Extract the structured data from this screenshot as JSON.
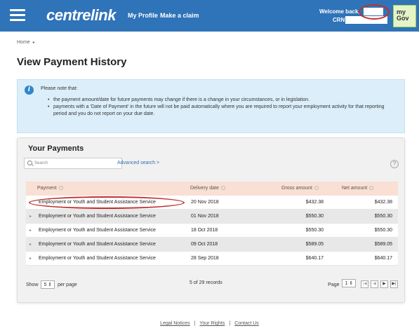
{
  "header": {
    "logo": "centrelink",
    "nav": {
      "profile": "My Profile",
      "claim": "Make a claim"
    },
    "welcome": "Welcome back,",
    "crn_label": "CRN",
    "mygov": {
      "line1": "my",
      "line2": "Gov"
    },
    "bg_color": "#2f73b8"
  },
  "breadcrumb": {
    "home": "Home",
    "arrow": "▸"
  },
  "page_title": "View Payment History",
  "notice": {
    "title": "Please note that:",
    "items": [
      "the payment amount/date for future payments may change if there is a change in your circumstances, or in legislation.",
      "payments with a 'Date of Payment' in the future will not be paid automatically where you are required to report your employment activity for that reporting period and you do not report on your due date."
    ]
  },
  "payments": {
    "title": "Your Payments",
    "search_placeholder": "Search",
    "advanced_search": "Advanced search >",
    "columns": [
      "Payment",
      "Delivery date",
      "Gross amount",
      "Net amount"
    ],
    "rows": [
      {
        "payment": "Employment or Youth and Student Assistance Service",
        "date": "20 Nov 2018",
        "gross": "$432.38",
        "net": "$432.38"
      },
      {
        "payment": "Employment or Youth and Student Assistance Service",
        "date": "01 Nov 2018",
        "gross": "$550.30",
        "net": "$550.30"
      },
      {
        "payment": "Employment or Youth and Student Assistance Service",
        "date": "18 Oct 2018",
        "gross": "$550.30",
        "net": "$550.30"
      },
      {
        "payment": "Employment or Youth and Student Assistance Service",
        "date": "09 Oct 2018",
        "gross": "$589.05",
        "net": "$589.05"
      },
      {
        "payment": "Employment or Youth and Student Assistance Service",
        "date": "28 Sep 2018",
        "gross": "$640.17",
        "net": "$640.17"
      }
    ],
    "show_label": "Show",
    "per_page_value": "5 ⇕",
    "per_page_label": "per page",
    "records": "5 of 29 records",
    "page_label": "Page",
    "page_value": "1 ⇕",
    "pager": {
      "first": "|◀",
      "prev": "◀",
      "next": "▶",
      "last": "▶|"
    },
    "header_bg": "#f9dfd4"
  },
  "footer": {
    "legal": "Legal Notices",
    "rights": "Your Rights",
    "contact": "Contact Us",
    "separator": "|"
  }
}
